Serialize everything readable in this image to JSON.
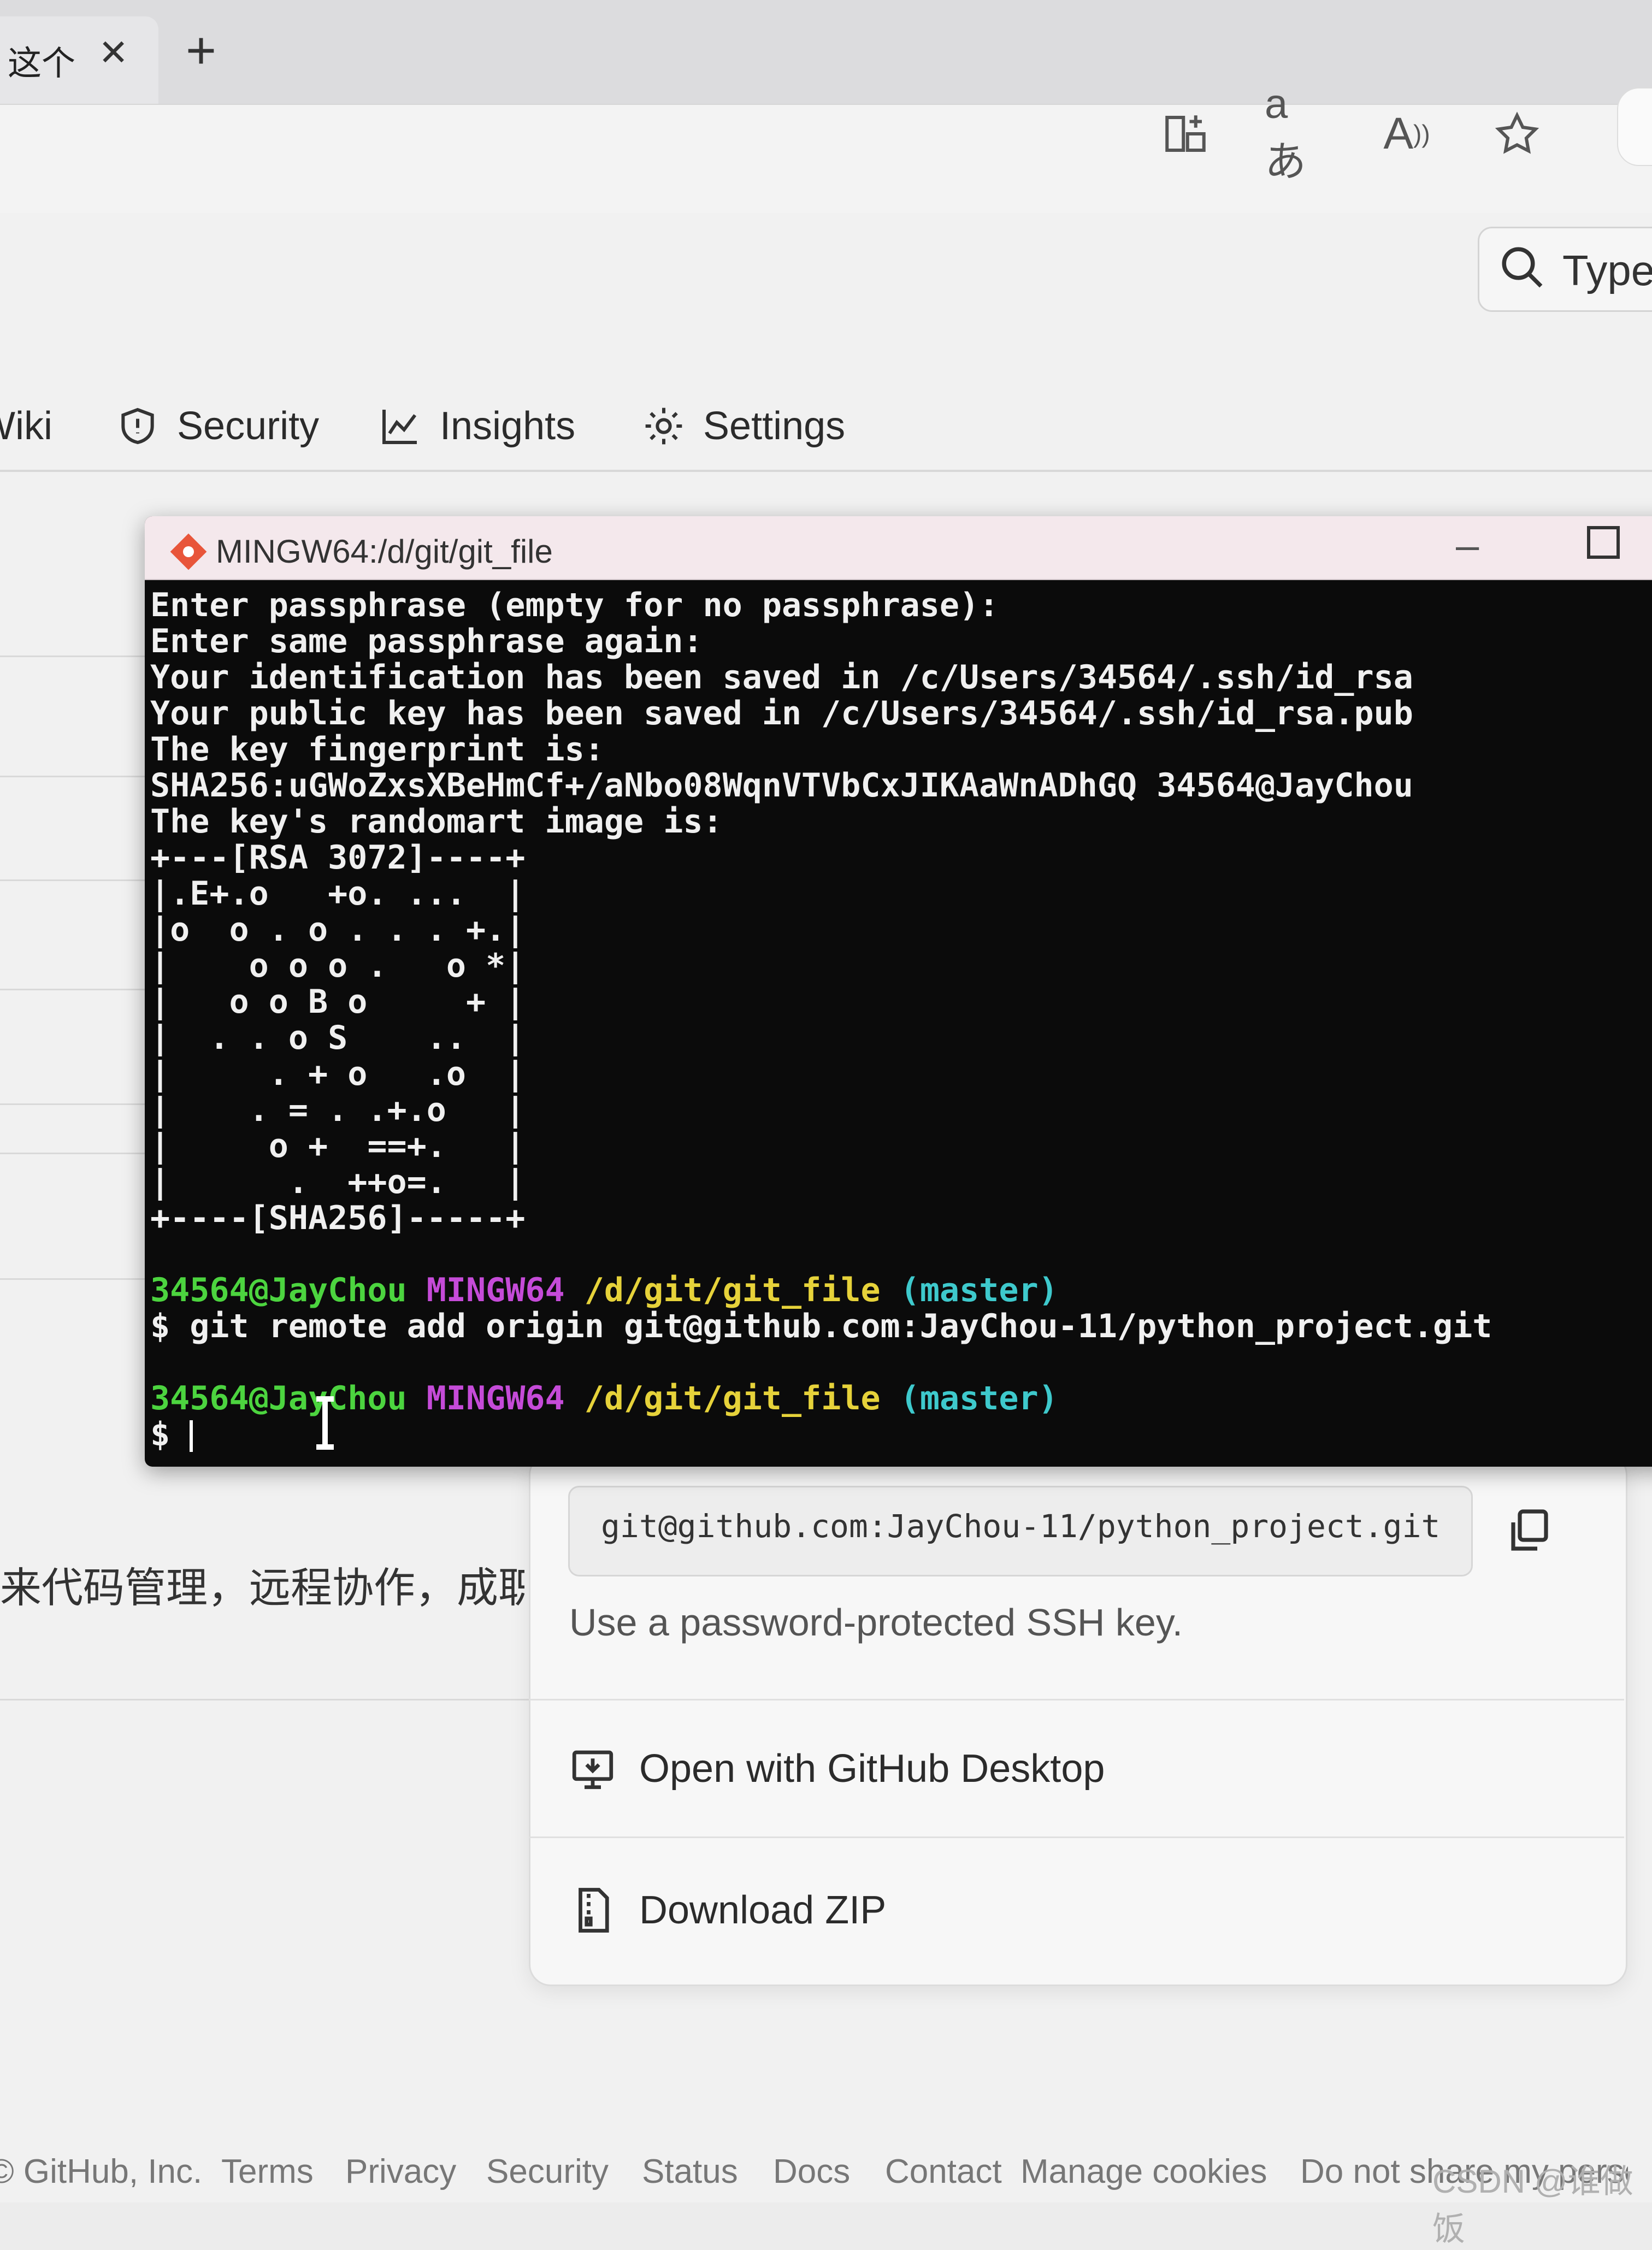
{
  "browser": {
    "tab_title": "这个",
    "tab_close": "✕",
    "new_tab": "+",
    "toolbar_icons": [
      "split-screen-icon",
      "translate-icon",
      "read-aloud-icon",
      "favorite-star-icon"
    ]
  },
  "github": {
    "search_placeholder": "Type",
    "nav": [
      {
        "label": "Wiki",
        "icon": "book-icon"
      },
      {
        "label": "Security",
        "icon": "shield-icon"
      },
      {
        "label": "Insights",
        "icon": "graph-icon"
      },
      {
        "label": "Settings",
        "icon": "gear-icon"
      }
    ],
    "chinese_text": "来代码管理，远程协作，成职",
    "clone": {
      "url": "git@github.com:JayChou-11/python_project.git",
      "hint": "Use a password-protected SSH key.",
      "open_desktop": "Open with GitHub Desktop",
      "download_zip": "Download ZIP"
    },
    "footer": [
      "© GitHub, Inc.",
      "Terms",
      "Privacy",
      "Security",
      "Status",
      "Docs",
      "Contact",
      "Manage cookies",
      "Do not share my perso"
    ]
  },
  "terminal": {
    "title": "MINGW64:/d/git/git_file",
    "lines": [
      "Enter passphrase (empty for no passphrase):",
      "Enter same passphrase again:",
      "Your identification has been saved in /c/Users/34564/.ssh/id_rsa",
      "Your public key has been saved in /c/Users/34564/.ssh/id_rsa.pub",
      "The key fingerprint is:",
      "SHA256:uGWoZxsXBeHmCf+/aNbo08WqnVTVbCxJIKAaWnADhGQ 34564@JayChou",
      "The key's randomart image is:",
      "+---[RSA 3072]----+",
      "|.E+.o   +o. ...  |",
      "|o  o . o . . . +.|",
      "|    o o o .   o *|",
      "|   o o B o     + |",
      "|  . . o S    ..  |",
      "|     . + o   .o  |",
      "|    . = . .+.o   |",
      "|     o +  ==+.   |",
      "|      .  ++o=.   |",
      "+----[SHA256]-----+"
    ],
    "prompt1": {
      "user": "34564@JayChou",
      "env": "MINGW64",
      "path": "/d/git/git_file",
      "branch": "(master)"
    },
    "command1": "$ git remote add origin git@github.com:JayChou-11/python_project.git",
    "prompt2": {
      "user": "34564@JayChou",
      "env": "MINGW64",
      "path": "/d/git/git_file",
      "branch": "(master)"
    },
    "command2": "$ "
  },
  "watermark": "CSDN @谁做饭"
}
